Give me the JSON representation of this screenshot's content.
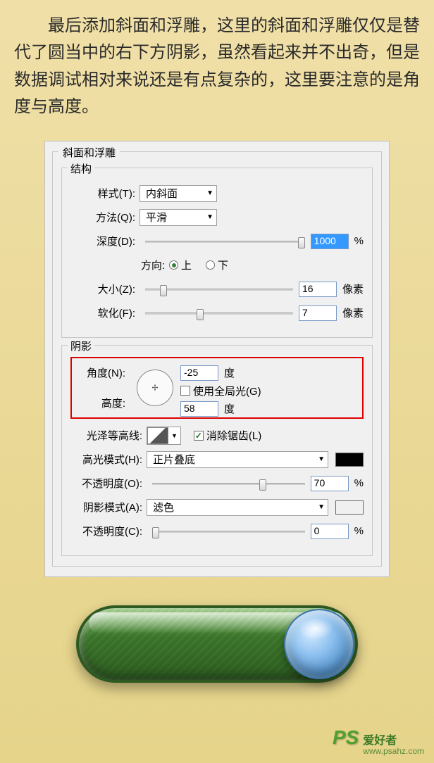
{
  "intro": "最后添加斜面和浮雕，这里的斜面和浮雕仅仅是替代了圆当中的右下方阴影，虽然看起来并不出奇，但是数据调试相对来说还是有点复杂的，这里要注意的是角度与高度。",
  "panel": {
    "title": "斜面和浮雕",
    "structure": {
      "title": "结构",
      "style_label": "样式(T):",
      "style_value": "内斜面",
      "method_label": "方法(Q):",
      "method_value": "平滑",
      "depth_label": "深度(D):",
      "depth_value": "1000",
      "depth_unit": "%",
      "direction_label": "方向:",
      "direction_up": "上",
      "direction_down": "下",
      "size_label": "大小(Z):",
      "size_value": "16",
      "size_unit": "像素",
      "soften_label": "软化(F):",
      "soften_value": "7",
      "soften_unit": "像素"
    },
    "shadow": {
      "title": "阴影",
      "angle_label": "角度(N):",
      "angle_value": "-25",
      "angle_unit": "度",
      "global_light_label": "使用全局光(G)",
      "altitude_label": "高度:",
      "altitude_value": "58",
      "altitude_unit": "度",
      "gloss_label": "光泽等高线:",
      "antialias_label": "消除锯齿(L)",
      "highlight_mode_label": "高光模式(H):",
      "highlight_mode_value": "正片叠底",
      "highlight_opacity_label": "不透明度(O):",
      "highlight_opacity_value": "70",
      "highlight_opacity_unit": "%",
      "shadow_mode_label": "阴影模式(A):",
      "shadow_mode_value": "滤色",
      "shadow_opacity_label": "不透明度(C):",
      "shadow_opacity_value": "0",
      "shadow_opacity_unit": "%",
      "highlight_color": "#000000",
      "shadow_color": "#f0f0f0"
    }
  },
  "watermark": {
    "logo": "PS",
    "cn": "爱好者",
    "url": "www.psahz.com"
  }
}
